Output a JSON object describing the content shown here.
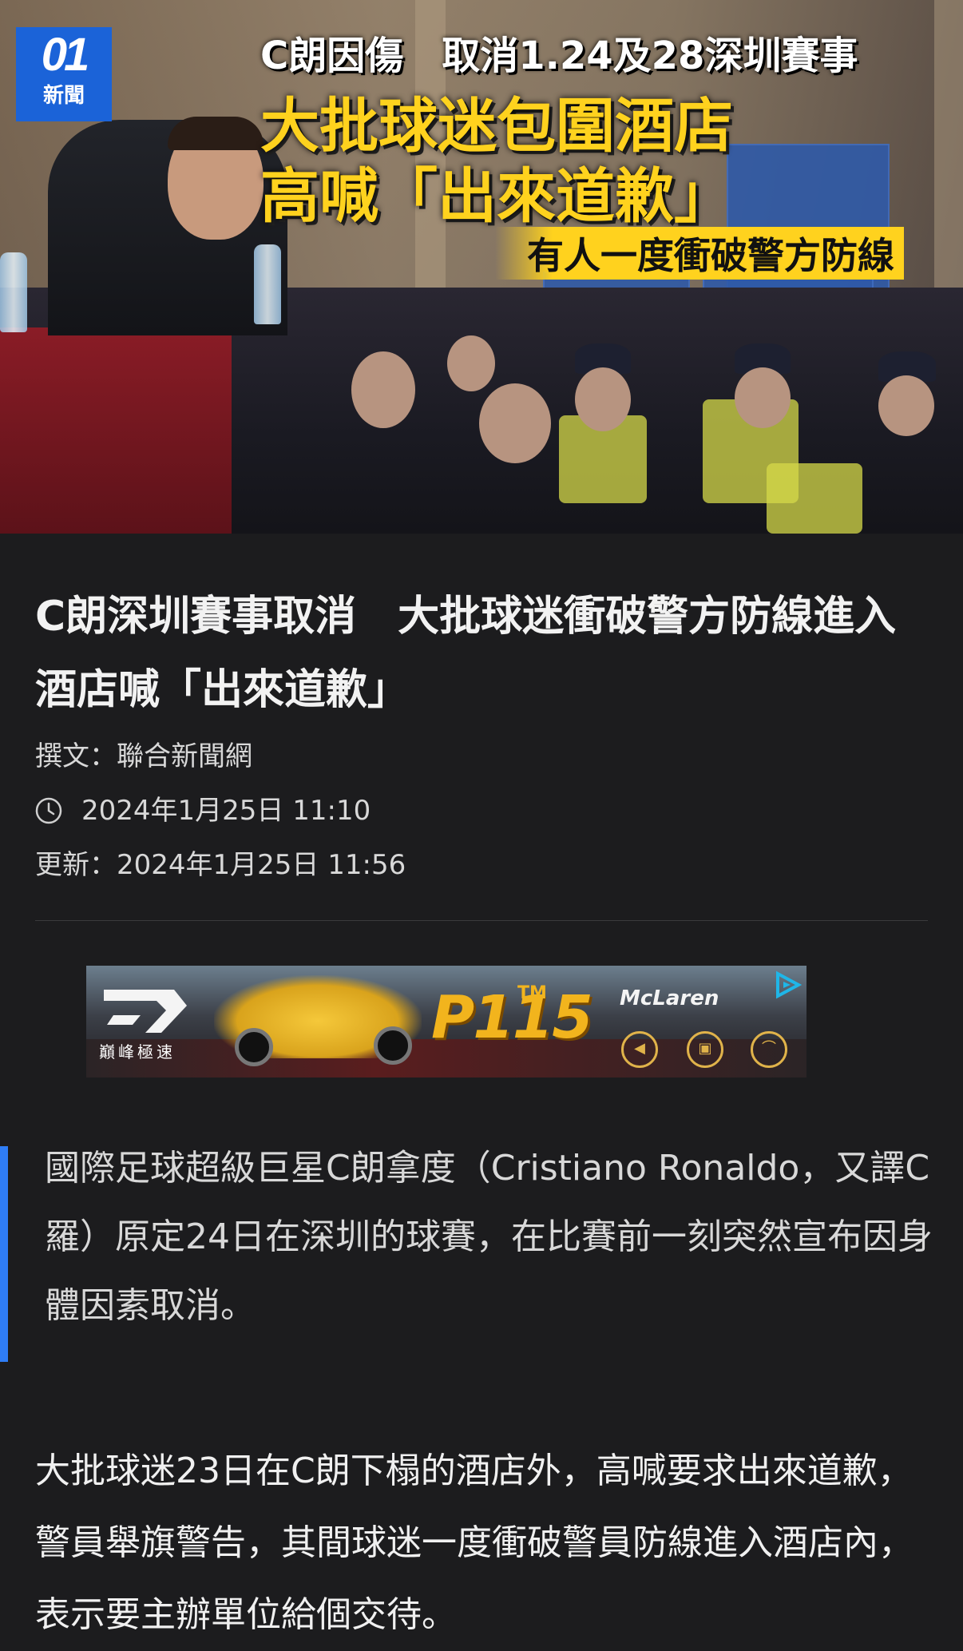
{
  "hero": {
    "logo_number": "01",
    "logo_text": "新聞",
    "headline_line1": "C朗因傷　取消1.24及28深圳賽事",
    "headline_line2": "大批球迷包圍酒店",
    "headline_line3": "高喊「出來道歉」",
    "headline_line4": "有人一度衝破警方防線"
  },
  "article": {
    "title": "C朗深圳賽事取消　大批球迷衝破警方防線進入酒店喊「出來道歉」",
    "author": "撰文：聯合新聞網",
    "published": "2024年1月25日 11:10",
    "updated": "更新：2024年1月25日 11:56"
  },
  "ad": {
    "brand_sub": "巔峰極速",
    "product": "P1",
    "product_tm": "TM",
    "product_num": "15",
    "maker": "McLaren"
  },
  "quote": {
    "text": "國際足球超級巨星C朗拿度（Cristiano Ronaldo，又譯C羅）原定24日在深圳的球賽，在比賽前一刻突然宣布因身體因素取消。"
  },
  "body": {
    "paragraph1": "大批球迷23日在C朗下榻的酒店外，高喊要求出來道歉，警員舉旗警告，其間球迷一度衝破警員防線進入酒店內，表示要主辦單位給個交待。"
  },
  "colors": {
    "background": "#1c1c1e",
    "accent_blue": "#2f7df6",
    "logo_blue": "#1b63d8",
    "headline_yellow": "#ffd21e"
  }
}
